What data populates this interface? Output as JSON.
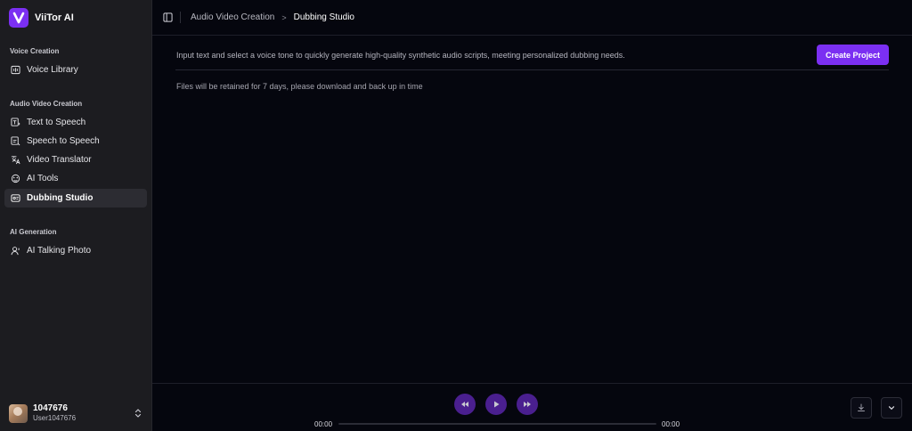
{
  "brand": {
    "name": "ViiTor AI",
    "logo_letter": "V"
  },
  "sidebar": {
    "sections": [
      {
        "title": "Voice Creation",
        "items": [
          {
            "label": "Voice Library",
            "icon": "voice-library-icon"
          }
        ]
      },
      {
        "title": "Audio Video Creation",
        "items": [
          {
            "label": "Text to Speech",
            "icon": "text-to-speech-icon"
          },
          {
            "label": "Speech to Speech",
            "icon": "speech-to-speech-icon"
          },
          {
            "label": "Video Translator",
            "icon": "video-translator-icon"
          },
          {
            "label": "AI Tools",
            "icon": "ai-tools-icon"
          },
          {
            "label": "Dubbing Studio",
            "icon": "dubbing-studio-icon",
            "active": true
          }
        ]
      },
      {
        "title": "AI Generation",
        "items": [
          {
            "label": "AI Talking Photo",
            "icon": "talking-photo-icon"
          }
        ]
      }
    ]
  },
  "user": {
    "id": "1047676",
    "name": "User1047676"
  },
  "header": {
    "breadcrumb": {
      "parent": "Audio Video Creation",
      "separator": ">",
      "current": "Dubbing Studio"
    }
  },
  "main": {
    "description": "Input text and select a voice tone to quickly generate high-quality synthetic audio scripts, meeting personalized dubbing needs.",
    "create_button": "Create Project",
    "notice": "Files will be retained for 7 days, please download and back up in time"
  },
  "player": {
    "current_time": "00:00",
    "total_time": "00:00",
    "progress": 0
  },
  "colors": {
    "accent": "#7b2ff2",
    "player_button": "#4a1f8f",
    "background": "#05060e",
    "sidebar": "#1c1c20"
  }
}
